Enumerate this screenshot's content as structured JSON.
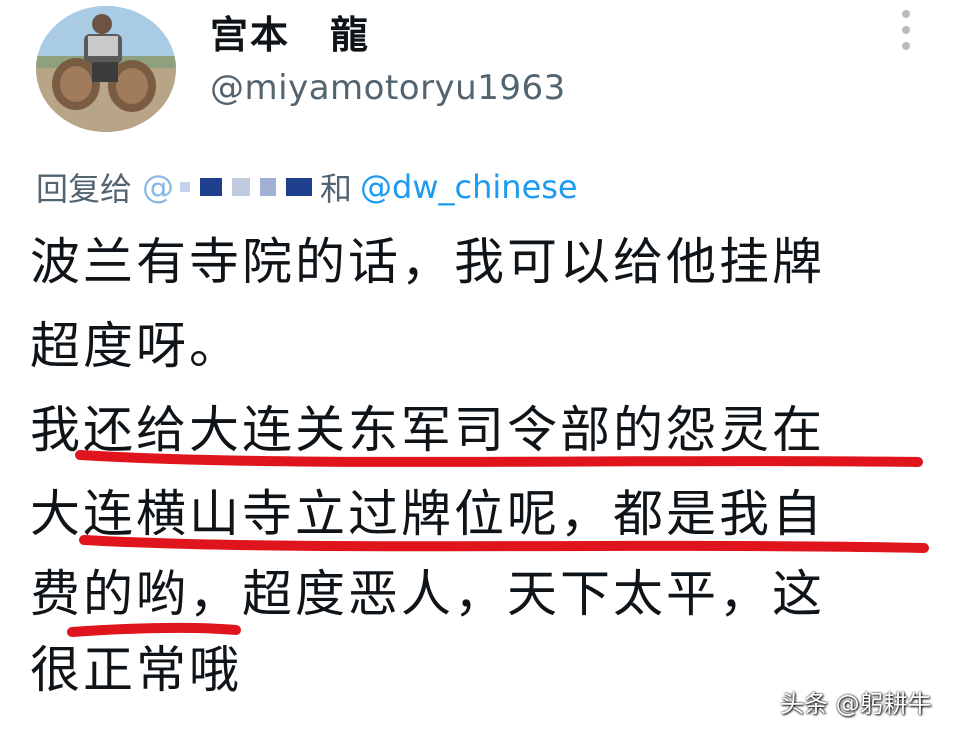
{
  "author": {
    "display_name": "宫本　龍",
    "handle": "@miyamotoryu1963"
  },
  "reply_to": {
    "prefix": "回复给",
    "first_mention_visible": "@",
    "conjunction": "和",
    "second_mention": "@dw_chinese"
  },
  "post": {
    "lines": [
      "波兰有寺院的话，我可以给他挂牌",
      "超度呀。",
      "我还给大连关东军司令部的怨灵在",
      "大连横山寺立过牌位呢，都是我自",
      "费的哟，超度恶人，天下太平，这",
      "很正常哦"
    ]
  },
  "watermark": "头条 @躬耕牛",
  "colors": {
    "handle_gray": "#536471",
    "mention_blue": "#1d9bf0",
    "underline_red": "#e0141c",
    "text": "#0f1419"
  },
  "icons": {
    "more": "vertical-ellipsis-icon",
    "avatar": "profile-photo"
  }
}
